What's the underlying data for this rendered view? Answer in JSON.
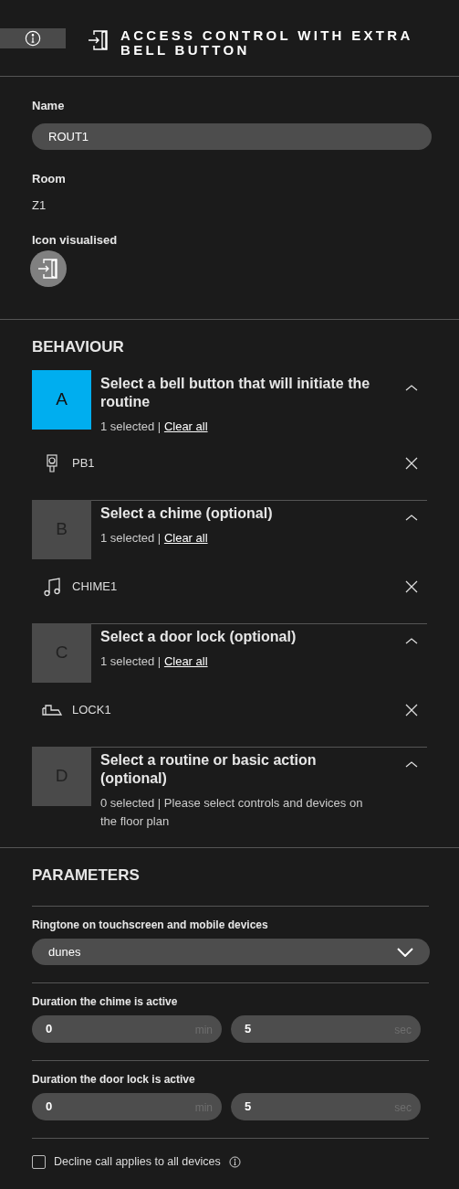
{
  "header": {
    "title": "ACCESS CONTROL WITH EXTRA BELL BUTTON"
  },
  "details": {
    "name_label": "Name",
    "name_value": "ROUT1",
    "room_label": "Room",
    "room_value": "Z1",
    "icon_label": "Icon visualised"
  },
  "behaviour": {
    "heading": "BEHAVIOUR",
    "steps": [
      {
        "letter": "A",
        "selected": true,
        "expanded": true,
        "title": "Select a bell button that will initiate the routine",
        "count": "1 selected | ",
        "clear": "Clear all",
        "items": [
          {
            "kind": "bell",
            "label": "PB1"
          }
        ]
      },
      {
        "letter": "B",
        "selected": false,
        "expanded": true,
        "title": "Select a chime (optional)",
        "count": "1 selected | ",
        "clear": "Clear all",
        "items": [
          {
            "kind": "chime",
            "label": "CHIME1"
          }
        ]
      },
      {
        "letter": "C",
        "selected": false,
        "expanded": true,
        "title": "Select a door lock (optional)",
        "count": "1 selected | ",
        "clear": "Clear all",
        "items": [
          {
            "kind": "lock",
            "label": "LOCK1"
          }
        ]
      },
      {
        "letter": "D",
        "selected": false,
        "expanded": true,
        "title": "Select a routine or basic action (optional)",
        "count": "0 selected | Please select controls and devices on the floor plan"
      }
    ]
  },
  "parameters": {
    "heading": "PARAMETERS",
    "rows": [
      {
        "kind": "select",
        "label": "Ringtone on touchscreen and mobile devices",
        "value": "dunes"
      },
      {
        "kind": "duration",
        "label": "Duration the chime is active",
        "min": "0",
        "min_unit": "min",
        "sec": "5",
        "sec_unit": "sec"
      },
      {
        "kind": "duration",
        "label": "Duration the door lock is active",
        "min": "0",
        "min_unit": "min",
        "sec": "5",
        "sec_unit": "sec"
      },
      {
        "kind": "checkbox",
        "label": "Decline call applies to all devices",
        "checked": false
      }
    ]
  }
}
